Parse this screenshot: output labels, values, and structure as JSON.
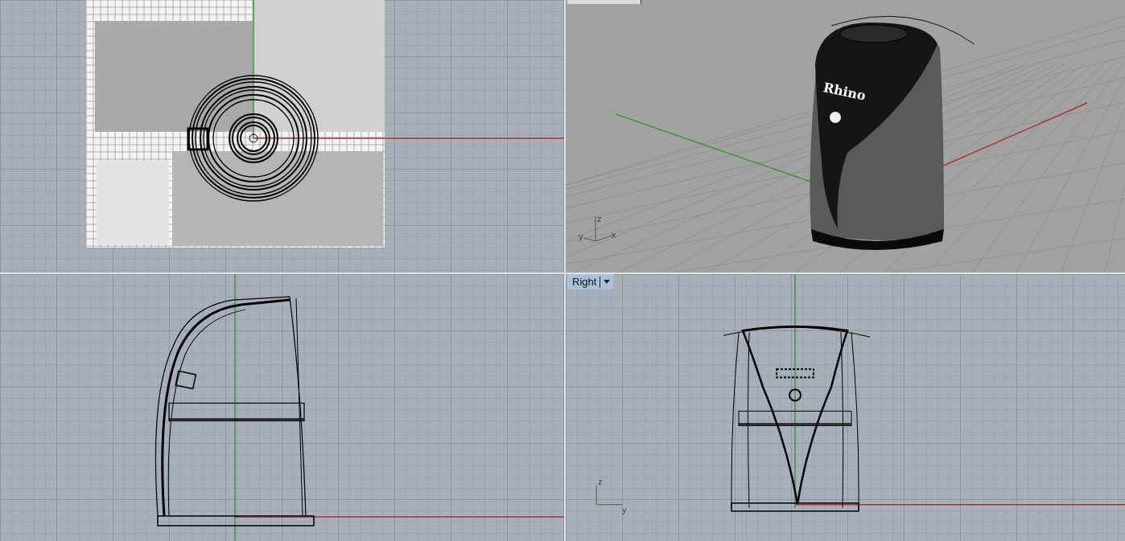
{
  "viewports": [
    {
      "kind": "top"
    },
    {
      "kind": "perspective",
      "axes": [
        "z",
        "y",
        "x"
      ],
      "model_label": "Rhino"
    },
    {
      "kind": "front"
    },
    {
      "kind": "right",
      "tab": {
        "label": "Right"
      },
      "axes": [
        "z",
        "y"
      ]
    }
  ]
}
